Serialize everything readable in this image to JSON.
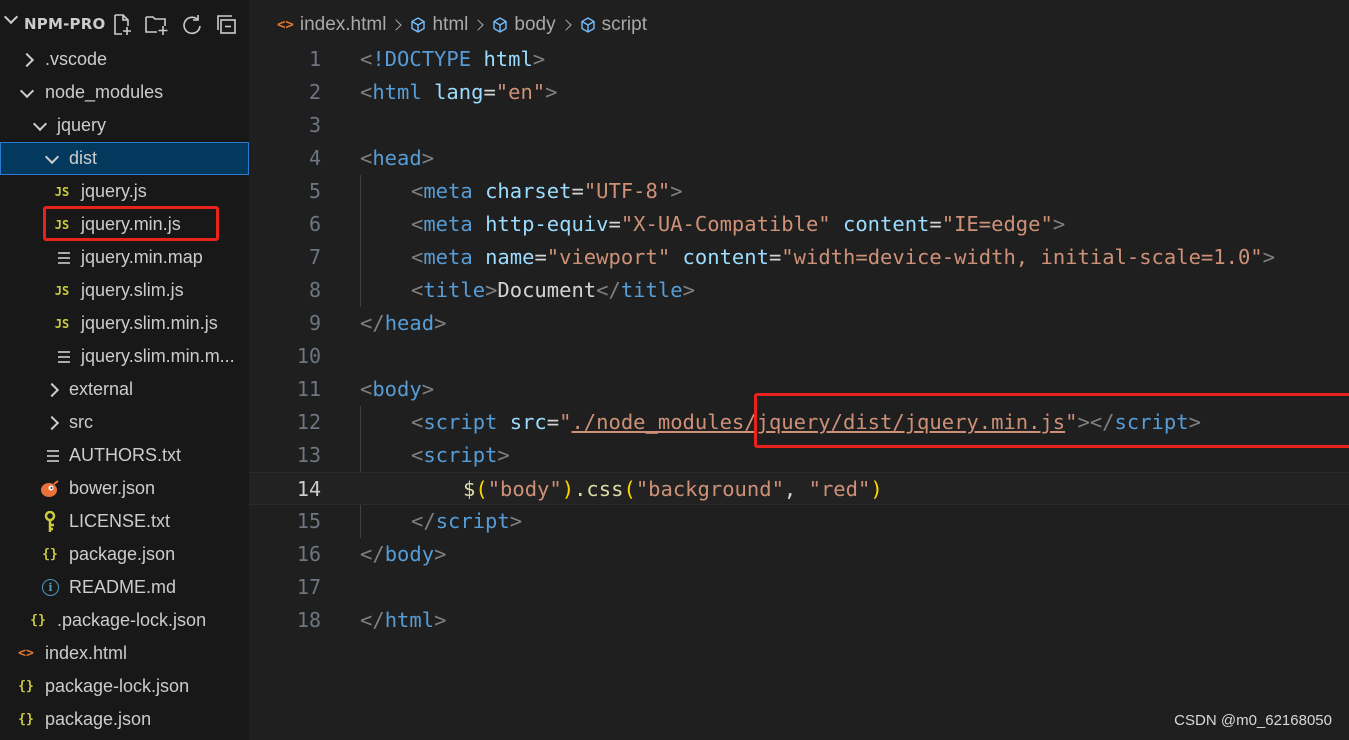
{
  "sidebar": {
    "title": "NPM-PRO",
    "actions": [
      "new-file-icon",
      "new-folder-icon",
      "refresh-icon",
      "collapse-all-icon"
    ],
    "tree": [
      {
        "label": ".vscode",
        "type": "folder",
        "expanded": false
      },
      {
        "label": "node_modules",
        "type": "folder",
        "expanded": true
      },
      {
        "label": "jquery",
        "type": "folder",
        "expanded": true
      },
      {
        "label": "dist",
        "type": "folder",
        "expanded": true,
        "selected": true
      },
      {
        "label": "jquery.js",
        "type": "js",
        "icon_text": "JS"
      },
      {
        "label": "jquery.min.js",
        "type": "js",
        "icon_text": "JS",
        "highlighted": true
      },
      {
        "label": "jquery.min.map",
        "type": "text"
      },
      {
        "label": "jquery.slim.js",
        "type": "js",
        "icon_text": "JS"
      },
      {
        "label": "jquery.slim.min.js",
        "type": "js",
        "icon_text": "JS"
      },
      {
        "label": "jquery.slim.min.m...",
        "type": "text"
      },
      {
        "label": "external",
        "type": "folder",
        "expanded": false
      },
      {
        "label": "src",
        "type": "folder",
        "expanded": false
      },
      {
        "label": "AUTHORS.txt",
        "type": "text"
      },
      {
        "label": "bower.json",
        "type": "bower"
      },
      {
        "label": "LICENSE.txt",
        "type": "license"
      },
      {
        "label": "package.json",
        "type": "json",
        "icon_text": "{}"
      },
      {
        "label": "README.md",
        "type": "info",
        "icon_text": "i"
      },
      {
        "label": ".package-lock.json",
        "type": "json",
        "icon_text": "{}"
      },
      {
        "label": "index.html",
        "type": "html",
        "icon_text": "<>"
      },
      {
        "label": "package-lock.json",
        "type": "json",
        "icon_text": "{}"
      },
      {
        "label": "package.json",
        "type": "json",
        "icon_text": "{}"
      }
    ]
  },
  "editor": {
    "breadcrumb": [
      {
        "label": "index.html",
        "icon": "html-file-icon",
        "icon_text": "<>"
      },
      {
        "label": "html",
        "icon": "element-cube-icon"
      },
      {
        "label": "body",
        "icon": "element-cube-icon"
      },
      {
        "label": "script",
        "icon": "element-cube-icon"
      }
    ],
    "active_line": 14,
    "lines": [
      {
        "n": "1"
      },
      {
        "n": "2"
      },
      {
        "n": "3"
      },
      {
        "n": "4"
      },
      {
        "n": "5"
      },
      {
        "n": "6"
      },
      {
        "n": "7"
      },
      {
        "n": "8"
      },
      {
        "n": "9"
      },
      {
        "n": "10"
      },
      {
        "n": "11"
      },
      {
        "n": "12"
      },
      {
        "n": "13"
      },
      {
        "n": "14"
      },
      {
        "n": "15"
      },
      {
        "n": "16"
      },
      {
        "n": "17"
      },
      {
        "n": "18"
      }
    ],
    "tokens": {
      "lt": "<",
      "gt": ">",
      "lt_slash": "</",
      "eq": "=",
      "sp": " ",
      "doctype": "!DOCTYPE",
      "html": "html",
      "lang": "lang",
      "en": "\"en\"",
      "head": "head",
      "meta": "meta",
      "charset": "charset",
      "utf8": "\"UTF-8\"",
      "http_equiv": "http-equiv",
      "xua": "\"X-UA-Compatible\"",
      "content": "content",
      "ie_edge": "\"IE=edge\"",
      "name": "name",
      "viewport": "\"viewport\"",
      "viewport_content": "\"width=device-width, initial-scale=1.0\"",
      "title": "title",
      "title_text": "Document",
      "body": "body",
      "script": "script",
      "src": "src",
      "q": "\"",
      "src_path": "./node_modules/jquery/dist/jquery.min.js",
      "dollar": "$",
      "lparen": "(",
      "rparen": ")",
      "body_str": "\"body\"",
      "dot_css": ".css",
      "bg_str": "\"background\"",
      "comma": ", ",
      "red_str": "\"red\""
    }
  },
  "watermark": "CSDN @m0_62168050",
  "colors": {
    "highlight_box": "#e8231d",
    "selection": "#04395e",
    "accent": "#2b79d0"
  }
}
